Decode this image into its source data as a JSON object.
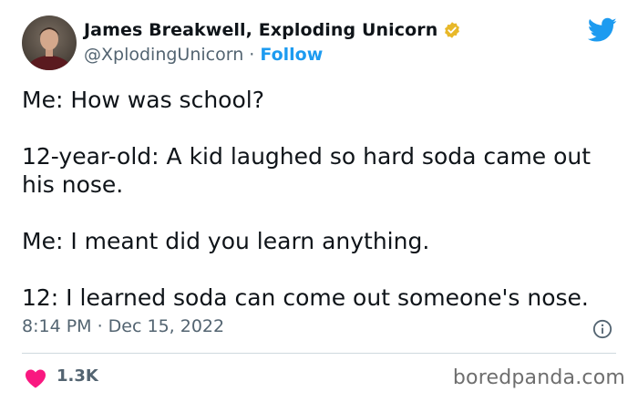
{
  "author": {
    "name": "James Breakwell, Exploding Unicorn",
    "handle": "@XplodingUnicorn",
    "separator": " · ",
    "follow_label": "Follow"
  },
  "tweet": {
    "paragraphs": [
      "Me: How was school?",
      "12-year-old: A kid laughed so hard soda came out\nhis nose.",
      "Me: I meant did you learn anything.",
      "12: I learned soda can come out someone's nose."
    ],
    "timestamp": "8:14 PM · Dec 15, 2022"
  },
  "engagement": {
    "likes": "1.3K"
  },
  "watermark": "boredpanda.com",
  "icons": {
    "verified": "verified-badge-icon",
    "platform": "twitter-bird-icon",
    "info": "info-icon",
    "like": "heart-icon"
  },
  "colors": {
    "verified": "#e8b829",
    "twitter_blue": "#1d9bf0",
    "like_red": "#f91880",
    "muted_text": "#536471"
  }
}
